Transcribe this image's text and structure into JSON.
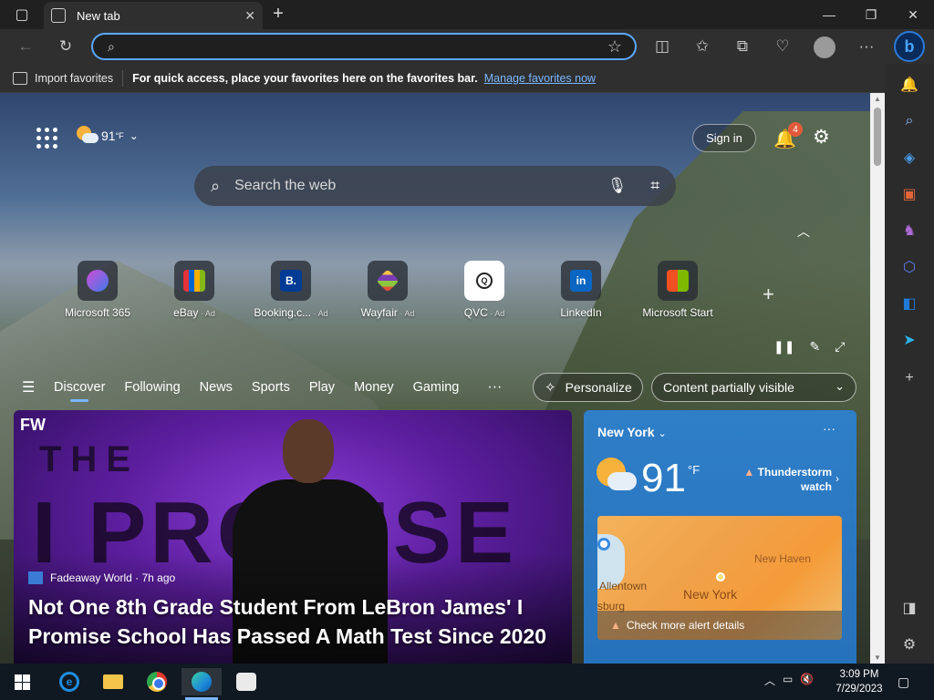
{
  "browser": {
    "tab_title": "New tab",
    "address_value": "",
    "favorites_bar": {
      "import_label": "Import favorites",
      "hint": "For quick access, place your favorites here on the favorites bar.",
      "manage_link": "Manage favorites now"
    }
  },
  "top": {
    "weather_temp": "91",
    "weather_unit": "°F",
    "sign_in": "Sign in",
    "notification_count": "4",
    "search_placeholder": "Search the web"
  },
  "quicklinks": [
    {
      "label": "Microsoft 365",
      "ad": ""
    },
    {
      "label": "eBay",
      "ad": " · Ad"
    },
    {
      "label": "Booking.c...",
      "ad": " · Ad"
    },
    {
      "label": "Wayfair",
      "ad": " · Ad"
    },
    {
      "label": "QVC",
      "ad": " · Ad"
    },
    {
      "label": "LinkedIn",
      "ad": ""
    },
    {
      "label": "Microsoft Start",
      "ad": ""
    }
  ],
  "feed_nav": {
    "tabs": [
      "Discover",
      "Following",
      "News",
      "Sports",
      "Play",
      "Money",
      "Gaming"
    ],
    "active": "Discover",
    "personalize": "Personalize",
    "content_visibility": "Content partially visible"
  },
  "hero": {
    "badge": "FW",
    "bg_text_1": "THE",
    "bg_text_2": "I PROMISE",
    "source": "Fadeaway World · 7h ago",
    "headline": "Not One 8th Grade Student From LeBron James' I Promise School Has Passed A Math Test Since 2020"
  },
  "weather_card": {
    "location": "New York",
    "temp": "91",
    "unit": "°F",
    "alert_title": "Thunderstorm",
    "alert_sub": "watch",
    "map_labels": {
      "new_york": "New York",
      "allentown": "Allentown",
      "new_haven": "New Haven",
      "burg": "sburg"
    },
    "map_footer": "Check more alert details"
  },
  "taskbar": {
    "time": "3:09 PM",
    "date": "7/29/2023"
  },
  "colors": {
    "accent": "#5aa9ff",
    "weather_card": "#2f7ec8",
    "notification_badge": "#e15b3a"
  }
}
